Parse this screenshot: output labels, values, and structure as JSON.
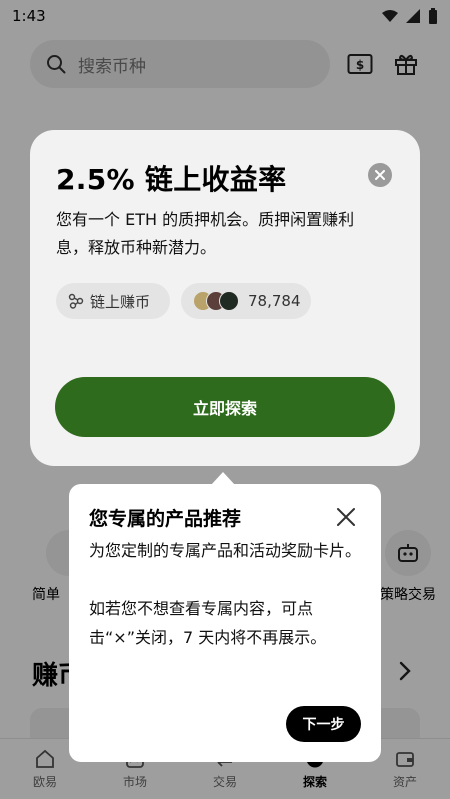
{
  "status_bar": {
    "time": "1:43"
  },
  "search": {
    "placeholder": "搜索币种"
  },
  "shortcuts": {
    "left_label": "简单",
    "right_label": "策略交易"
  },
  "earn_section": {
    "title": "赚币"
  },
  "promo": {
    "title": "2.5% 链上收益率",
    "description": "您有一个 ETH 的质押机会。质押闲置赚利息，释放币种新潜力。",
    "chip_label": "链上赚币",
    "participants": "78,784",
    "cta_label": "立即探索",
    "cta_color": "#2f6b1c"
  },
  "tooltip": {
    "title": "您专属的产品推荐",
    "paragraph1": "为您定制的专属产品和活动奖励卡片。",
    "paragraph2": "如若您不想查看专属内容，可点击“×”关闭，7 天内将不再展示。",
    "next_label": "下一步"
  },
  "bottom_nav": {
    "items": [
      {
        "label": "欧易",
        "icon": "home-icon"
      },
      {
        "label": "市场",
        "icon": "market-icon"
      },
      {
        "label": "交易",
        "icon": "trade-icon"
      },
      {
        "label": "探索",
        "icon": "explore-icon",
        "active": true
      },
      {
        "label": "资产",
        "icon": "wallet-icon"
      }
    ]
  }
}
